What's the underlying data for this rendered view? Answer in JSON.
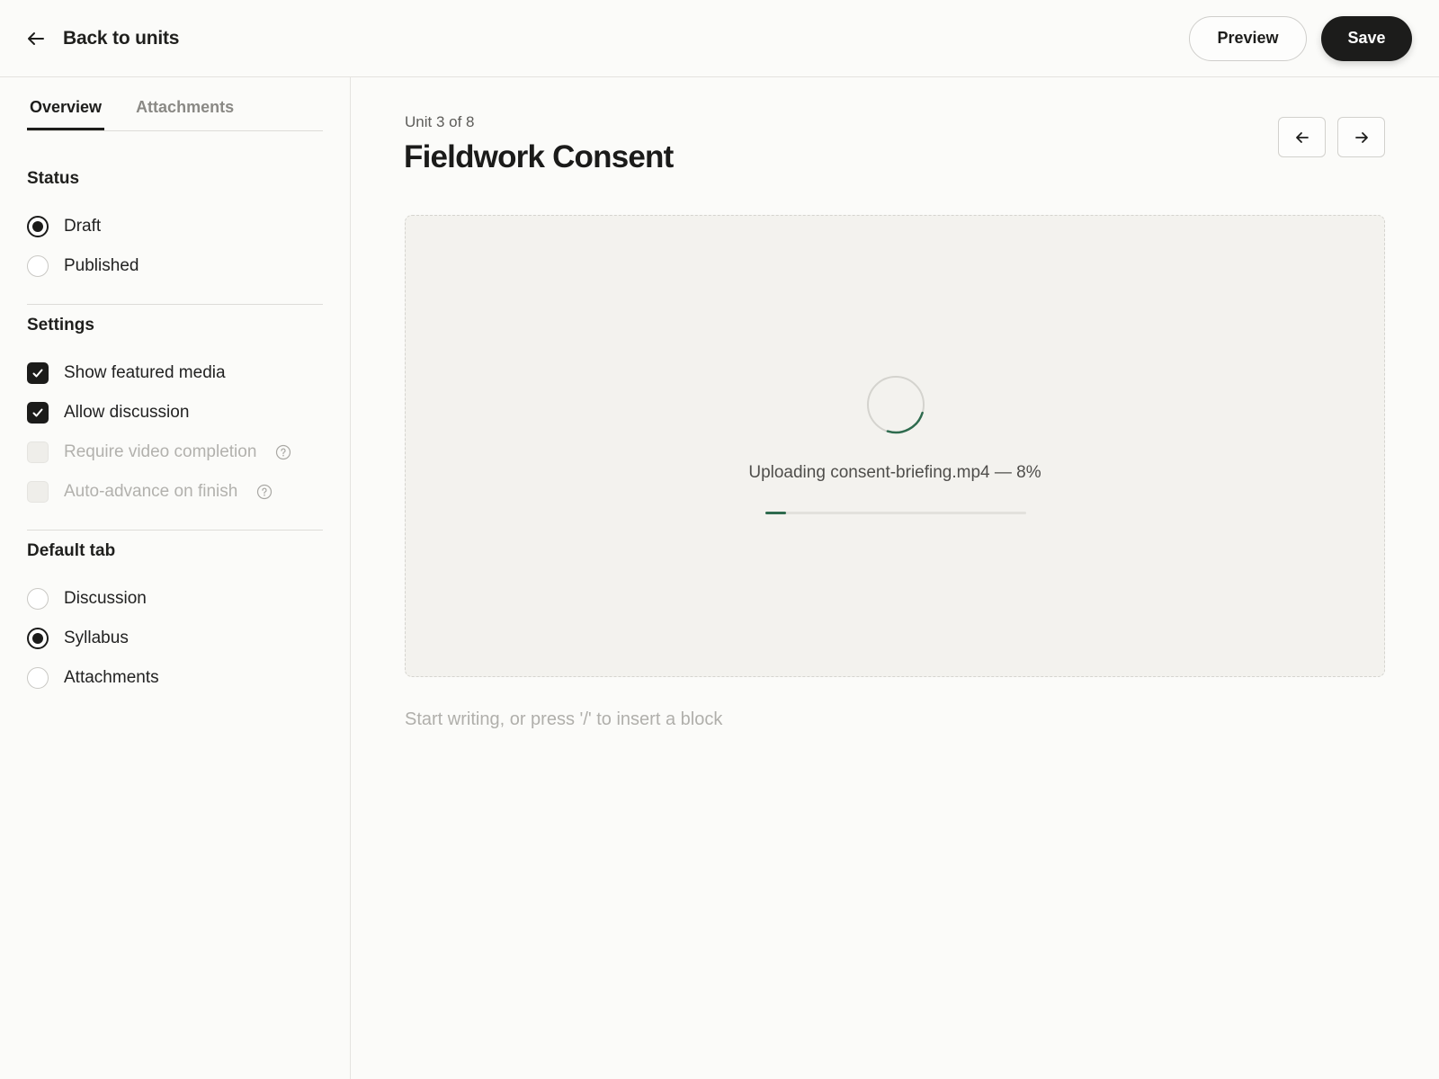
{
  "header": {
    "back_label": "Back to units",
    "preview_label": "Preview",
    "save_label": "Save"
  },
  "sidebar": {
    "tabs": [
      {
        "label": "Overview",
        "active": true
      },
      {
        "label": "Attachments",
        "active": false
      }
    ],
    "status": {
      "title": "Status",
      "options": [
        {
          "label": "Draft",
          "selected": true
        },
        {
          "label": "Published",
          "selected": false
        }
      ]
    },
    "settings": {
      "title": "Settings",
      "options": [
        {
          "label": "Show featured media",
          "checked": true,
          "disabled": false
        },
        {
          "label": "Allow discussion",
          "checked": true,
          "disabled": false
        },
        {
          "label": "Require video completion",
          "checked": false,
          "disabled": true
        },
        {
          "label": "Auto-advance on finish",
          "checked": false,
          "disabled": true
        }
      ]
    },
    "default_tab": {
      "title": "Default tab",
      "options": [
        {
          "label": "Discussion",
          "selected": false
        },
        {
          "label": "Syllabus",
          "selected": true
        },
        {
          "label": "Attachments",
          "selected": false
        }
      ]
    }
  },
  "main": {
    "unit_count": "Unit 3 of 8",
    "title": "Fieldwork Consent",
    "upload": {
      "text": "Uploading consent-briefing.mp4 — 8%",
      "progress": 0.08
    },
    "editor_placeholder": "Start writing, or press '/' to insert a block"
  },
  "colors": {
    "accent": "#2e6b4e",
    "primary_button": "#1c1c1b",
    "background": "#fbfbf9",
    "dropzone": "#f3f2ee"
  }
}
